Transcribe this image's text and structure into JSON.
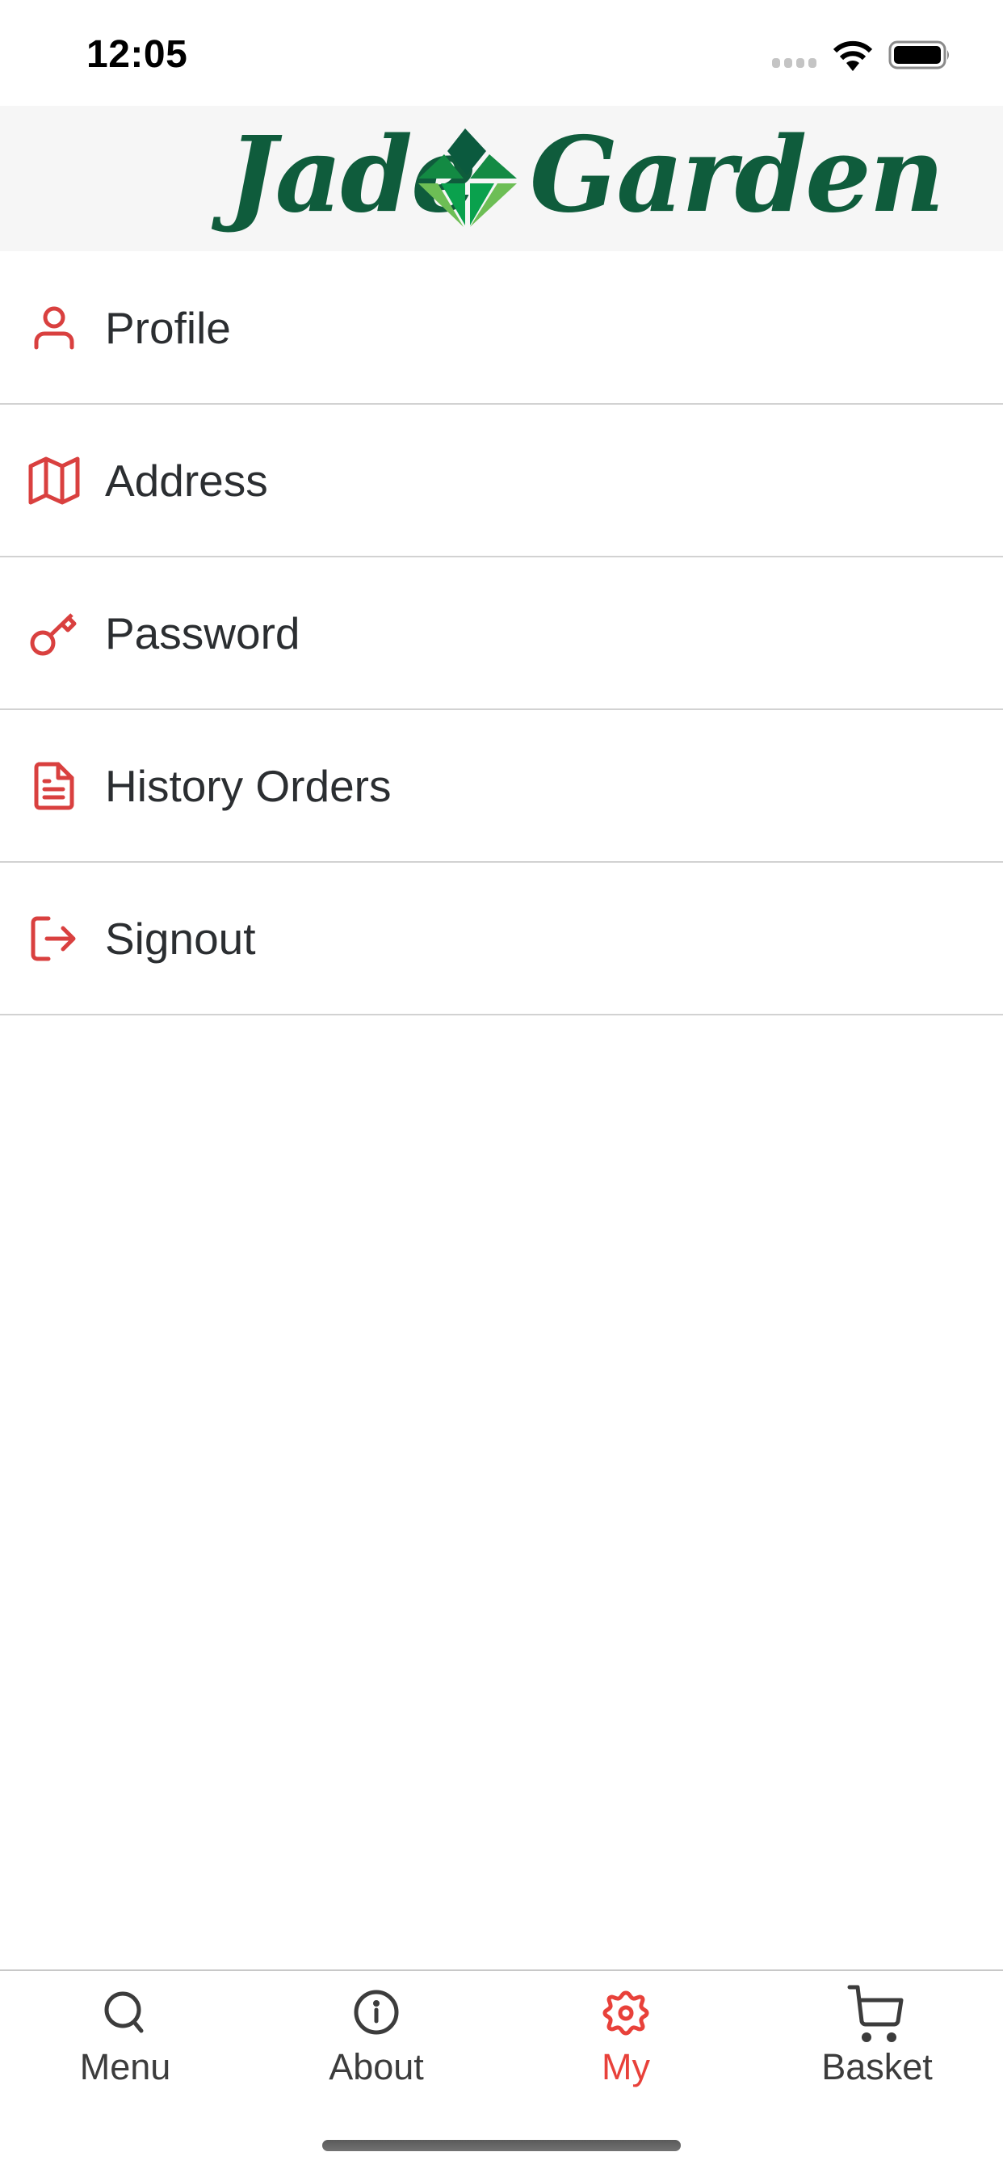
{
  "status_bar": {
    "time": "12:05",
    "icons": [
      "signal-dots-icon",
      "wifi-icon",
      "battery-icon"
    ]
  },
  "header": {
    "logo_text_left": "Jade",
    "logo_text_right": "Garden",
    "logo_icon": "gem-icon",
    "brand_color": "#0f5c3c"
  },
  "menu": {
    "accent_color": "#d9403f",
    "items": [
      {
        "label": "Profile",
        "icon": "user-icon"
      },
      {
        "label": "Address",
        "icon": "map-icon"
      },
      {
        "label": "Password",
        "icon": "key-icon"
      },
      {
        "label": "History Orders",
        "icon": "document-icon"
      },
      {
        "label": "Signout",
        "icon": "sign-out-icon"
      }
    ]
  },
  "tab_bar": {
    "active_color": "#e8413a",
    "inactive_color": "#3c3c3c",
    "active_tab": "My",
    "tabs": [
      {
        "label": "Menu",
        "icon": "search-icon"
      },
      {
        "label": "About",
        "icon": "info-icon"
      },
      {
        "label": "My",
        "icon": "gear-icon"
      },
      {
        "label": "Basket",
        "icon": "cart-icon"
      }
    ]
  }
}
